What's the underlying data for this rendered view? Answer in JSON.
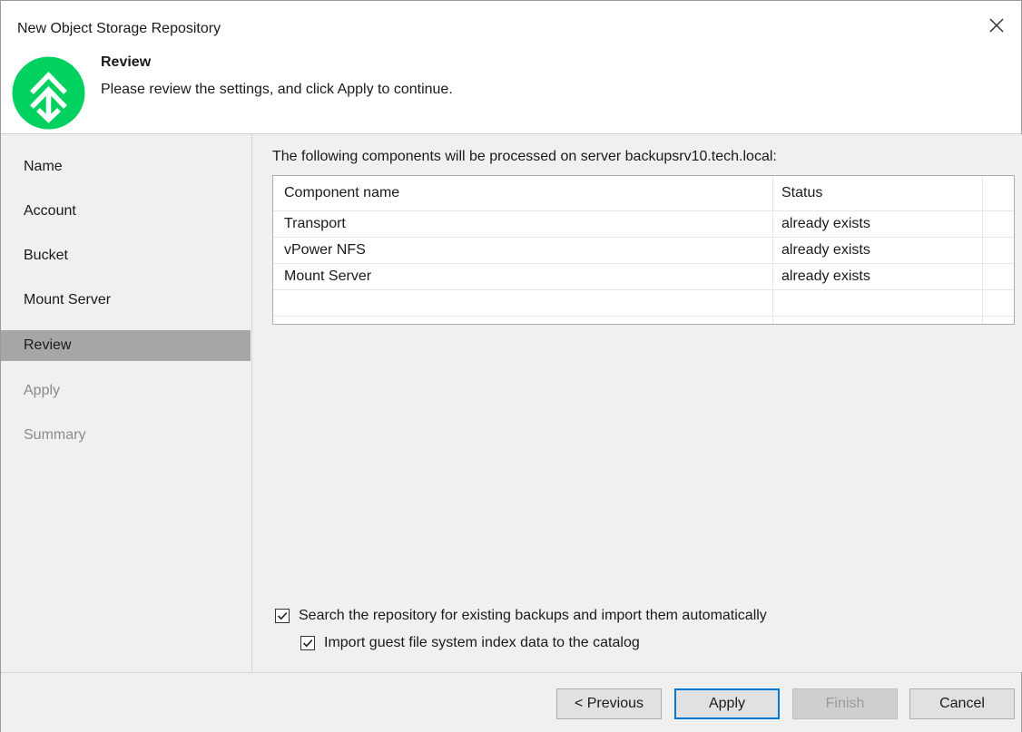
{
  "window": {
    "title": "New Object Storage Repository"
  },
  "header": {
    "title": "Review",
    "subtitle": "Please review the settings, and click Apply to continue."
  },
  "sidebar": {
    "items": [
      {
        "label": "Name",
        "state": "normal"
      },
      {
        "label": "Account",
        "state": "normal"
      },
      {
        "label": "Bucket",
        "state": "normal"
      },
      {
        "label": "Mount Server",
        "state": "normal"
      },
      {
        "label": "Review",
        "state": "active"
      },
      {
        "label": "Apply",
        "state": "disabled"
      },
      {
        "label": "Summary",
        "state": "disabled"
      }
    ]
  },
  "main": {
    "intro": "The following components will be processed on server backupsrv10.tech.local:",
    "table": {
      "columns": [
        "Component name",
        "Status"
      ],
      "rows": [
        {
          "name": "Transport",
          "status": "already exists"
        },
        {
          "name": "vPower NFS",
          "status": "already exists"
        },
        {
          "name": "Mount Server",
          "status": "already exists"
        }
      ]
    },
    "options": {
      "search_label": "Search the repository for existing backups and import them automatically",
      "search_checked": true,
      "import_label": "Import guest file system index data to the catalog",
      "import_checked": true
    }
  },
  "footer": {
    "previous": "< Previous",
    "apply": "Apply",
    "finish": "Finish",
    "cancel": "Cancel"
  },
  "colors": {
    "logo_green": "#00d15f",
    "active_nav": "#a6a6a6",
    "primary_border": "#0078d7"
  }
}
